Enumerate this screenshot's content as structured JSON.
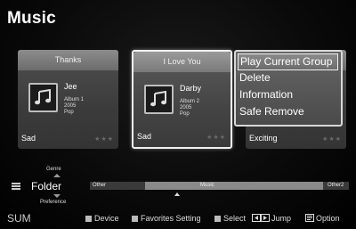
{
  "app": {
    "title": "Music"
  },
  "cards": [
    {
      "title": "Thanks",
      "artist": "Jee",
      "album": "Album 1",
      "year": "2005",
      "genre": "Pop",
      "mood": "Sad",
      "stars": "★★★"
    },
    {
      "title": "I Love You",
      "artist": "Darby",
      "album": "Album 2",
      "year": "2005",
      "genre": "Pop",
      "mood": "Sad",
      "stars": "★★★"
    },
    {
      "mood": "Exciting",
      "stars": "★★★"
    }
  ],
  "menu": {
    "items": [
      "Play Current Group",
      "Delete",
      "Information",
      "Safe Remove"
    ],
    "selected_index": 0
  },
  "sort": {
    "up_label": "Genre",
    "current": "Folder",
    "down_label": "Preference",
    "segments": [
      "Other",
      "Music",
      "Other2"
    ]
  },
  "bottom": {
    "device_label": "SUM",
    "device_btn": "Device",
    "favorites_btn": "Favorites Setting",
    "select_btn": "Select",
    "jump_btn": "Jump",
    "option_btn": "Option"
  }
}
